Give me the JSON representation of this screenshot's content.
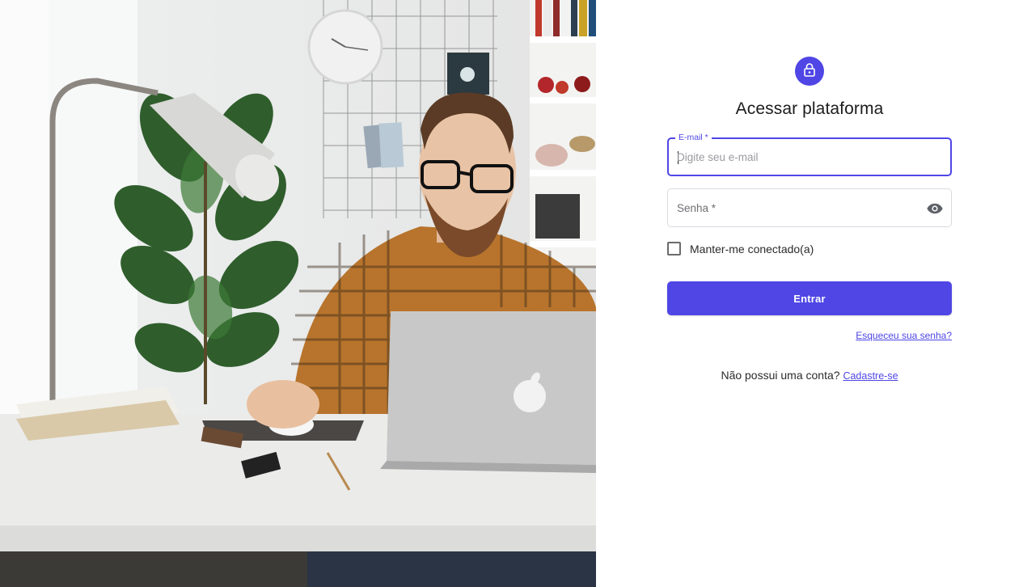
{
  "hero": {
    "image_alt": "Man with glasses working on a laptop at a home office desk"
  },
  "login": {
    "title": "Acessar plataforma",
    "email": {
      "label": "E-mail *",
      "placeholder": "Digite seu e-mail",
      "value": ""
    },
    "password": {
      "label": "Senha *",
      "value": ""
    },
    "remember_label": "Manter-me conectado(a)",
    "remember_checked": false,
    "submit_label": "Entrar",
    "forgot_label": "Esqueceu sua senha?",
    "signup_prompt": "Não possui uma conta?",
    "signup_link": "Cadastre-se"
  },
  "icons": {
    "lock": "lock-icon",
    "eye": "eye-icon"
  },
  "colors": {
    "accent": "#4f46e5",
    "text": "#1c1c1c",
    "field_border": "#d9dbe0"
  }
}
